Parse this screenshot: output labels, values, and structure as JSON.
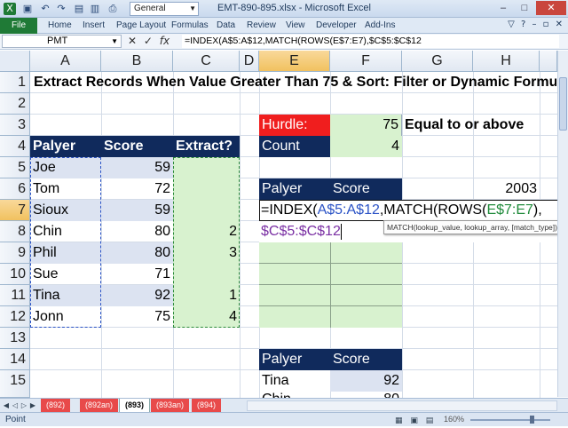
{
  "window": {
    "title": "EMT-890-895.xlsx - Microsoft Excel",
    "style_box": "General",
    "controls": [
      "–",
      "□",
      "✕"
    ]
  },
  "ribbon": {
    "file_tab": "File",
    "tabs": [
      "Home",
      "Insert",
      "Page Layout",
      "Formulas",
      "Data",
      "Review",
      "View",
      "Developer",
      "Add-Ins"
    ]
  },
  "formula_bar": {
    "name_box": "PMT",
    "formula": "=INDEX(A$5:A$12,MATCH(ROWS(E$7:E7),$C$5:$C$12"
  },
  "columns": [
    "A",
    "B",
    "C",
    "D",
    "E",
    "F",
    "G",
    "H"
  ],
  "rows": [
    "1",
    "2",
    "3",
    "4",
    "5",
    "6",
    "7",
    "8",
    "9",
    "10",
    "11",
    "12",
    "13",
    "14",
    "15"
  ],
  "sheet": {
    "title": "Extract Records When Value Greater Than 75 & Sort: Filter or Dynamic Formul",
    "header_name": "Palyer",
    "header_score": "Score",
    "header_extract": "Extract?",
    "data": [
      {
        "name": "Joe",
        "score": "59",
        "extract": ""
      },
      {
        "name": "Tom",
        "score": "72",
        "extract": ""
      },
      {
        "name": "Sioux",
        "score": "59",
        "extract": ""
      },
      {
        "name": "Chin",
        "score": "80",
        "extract": "2"
      },
      {
        "name": "Phil",
        "score": "80",
        "extract": "3"
      },
      {
        "name": "Sue",
        "score": "71",
        "extract": ""
      },
      {
        "name": "Tina",
        "score": "92",
        "extract": "1"
      },
      {
        "name": "Jonn",
        "score": "75",
        "extract": "4"
      }
    ],
    "hurdle_label": "Hurdle:",
    "hurdle_value": "75",
    "hurdle_note": "Equal to or above",
    "count_label": "Count",
    "count_value": "4",
    "out_header_name": "Palyer",
    "out_header_score": "Score",
    "h6_value": "2003",
    "edit_line1_parts": [
      "=INDEX(",
      "A$5:A$12",
      ",MATCH(ROWS(",
      "E$7:E7",
      "),"
    ],
    "edit_line2": "$C$5:$C$12",
    "tooltip": "MATCH(lookup_value, lookup_array, [match_type])",
    "filter_header_name": "Palyer",
    "filter_header_score": "Score",
    "filter_rows": [
      {
        "name": "Tina",
        "score": "92"
      },
      {
        "name": "Chin",
        "score": "80"
      }
    ]
  },
  "sheet_tabs": [
    "(892)",
    "(892an)",
    "(893)",
    "(893an)",
    "(894)"
  ],
  "active_tab": "(893)",
  "status": {
    "mode": "Point",
    "zoom": "160%"
  }
}
